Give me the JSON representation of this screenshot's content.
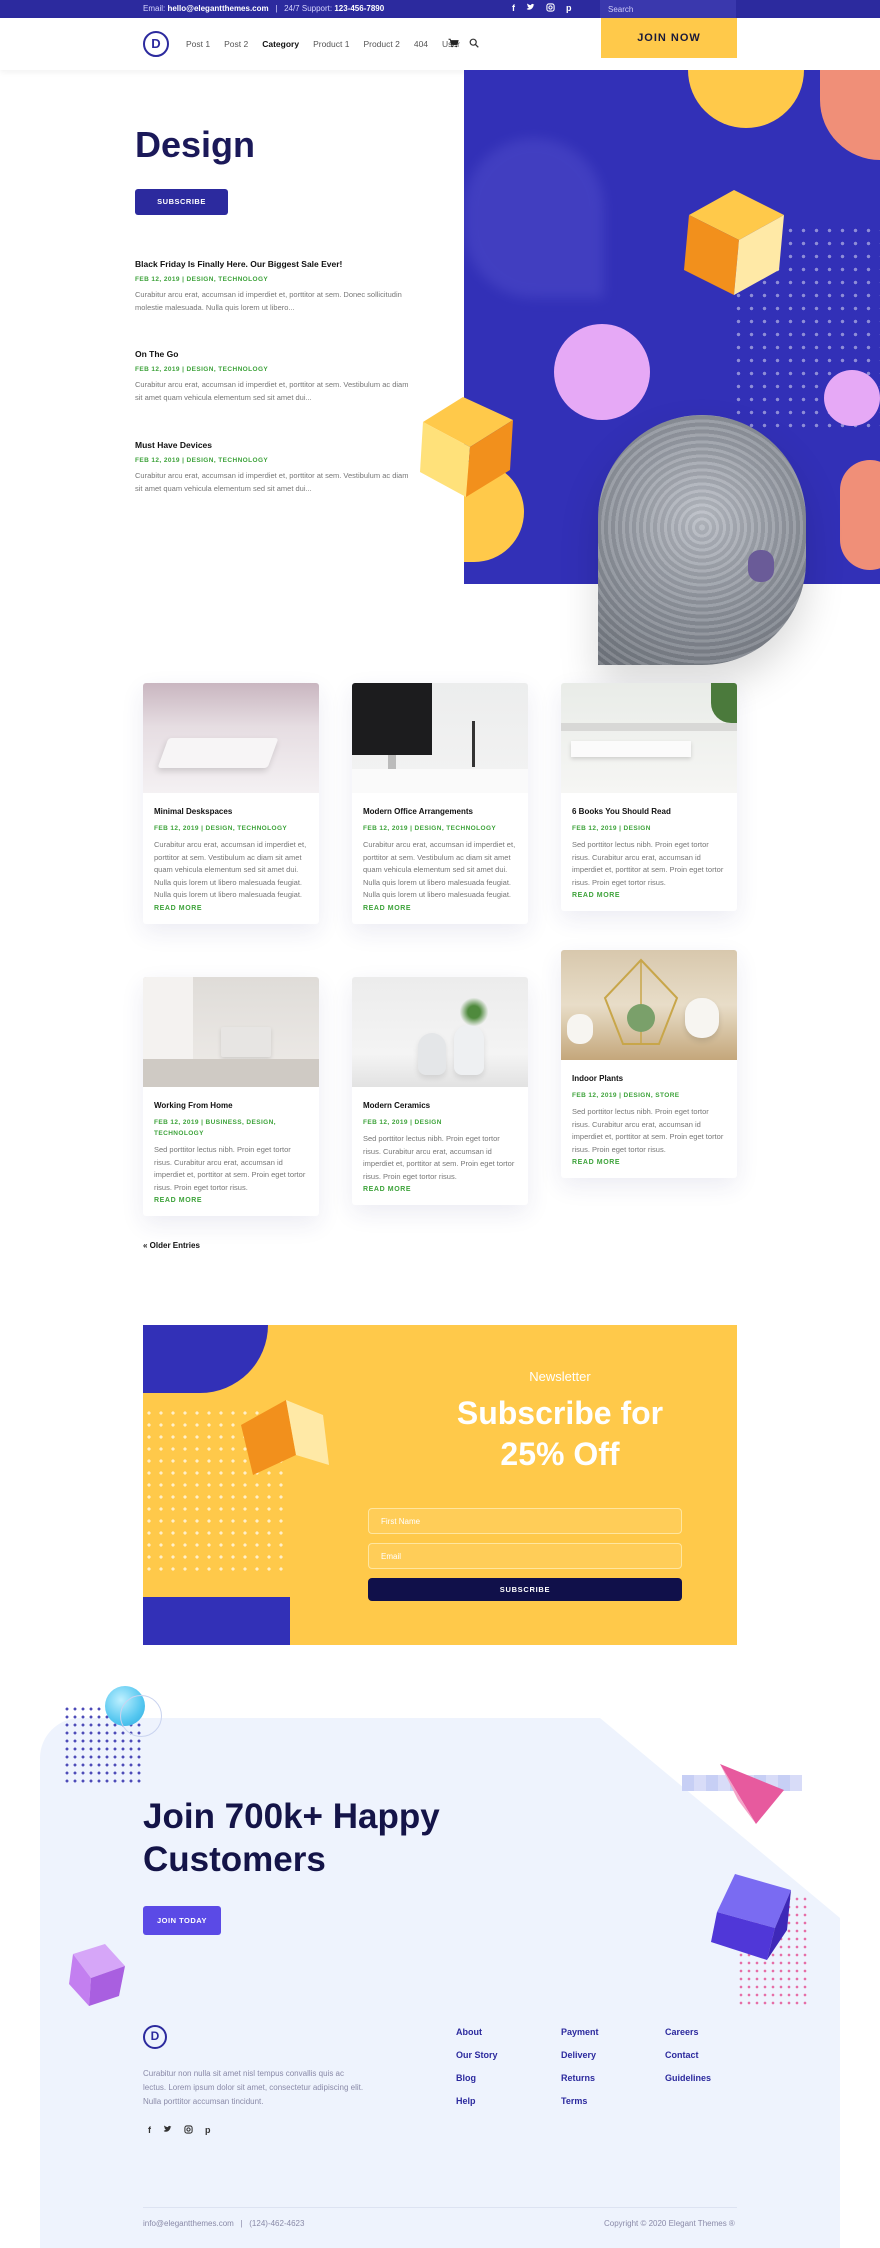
{
  "topbar": {
    "email_label": "Email:",
    "email": "hello@elegantthemes.com",
    "separator": "|",
    "support_label": "24/7 Support:",
    "phone": "123-456-7890",
    "social_icons": [
      "facebook-icon",
      "twitter-icon",
      "instagram-icon",
      "pinterest-icon"
    ],
    "search_placeholder": "Search"
  },
  "nav": {
    "logo_letter": "D",
    "items": [
      "Post 1",
      "Post 2",
      "Category",
      "Product 1",
      "Product 2",
      "404",
      "User"
    ],
    "active_item": "Category",
    "join_label": "JOIN NOW"
  },
  "hero": {
    "title": "Design",
    "subscribe_label": "SUBSCRIBE",
    "posts": [
      {
        "title": "Black Friday Is Finally Here. Our Biggest Sale Ever!",
        "meta": "FEB 12, 2019 | DESIGN, TECHNOLOGY",
        "excerpt": "Curabitur arcu erat, accumsan id imperdiet et, porttitor at sem. Donec sollicitudin molestie malesuada. Nulla quis lorem ut libero..."
      },
      {
        "title": "On The Go",
        "meta": "FEB 12, 2019 | DESIGN, TECHNOLOGY",
        "excerpt": "Curabitur arcu erat, accumsan id imperdiet et, porttitor at sem. Vestibulum ac diam sit amet quam vehicula elementum sed sit amet dui..."
      },
      {
        "title": "Must Have Devices",
        "meta": "FEB 12, 2019 | DESIGN, TECHNOLOGY",
        "excerpt": "Curabitur arcu erat, accumsan id imperdiet et, porttitor at sem. Vestibulum ac diam sit amet quam vehicula elementum sed sit amet dui..."
      }
    ]
  },
  "grid": {
    "read_more": "READ MORE",
    "cards": [
      {
        "title": "Minimal Deskspaces",
        "meta": "FEB 12, 2019 | DESIGN, TECHNOLOGY",
        "excerpt": "Curabitur arcu erat, accumsan id imperdiet et, porttitor at sem. Vestibulum ac diam sit amet quam vehicula elementum sed sit amet dui. Nulla quis lorem ut libero malesuada feugiat. Nulla quis lorem ut libero malesuada feugiat."
      },
      {
        "title": "Modern Office Arrangements",
        "meta": "FEB 12, 2019 | DESIGN, TECHNOLOGY",
        "excerpt": "Curabitur arcu erat, accumsan id imperdiet et, porttitor at sem. Vestibulum ac diam sit amet quam vehicula elementum sed sit amet dui. Nulla quis lorem ut libero malesuada feugiat. Nulla quis lorem ut libero malesuada feugiat."
      },
      {
        "title": "6 Books You Should Read",
        "meta": "FEB 12, 2019 | DESIGN",
        "excerpt": "Sed porttitor lectus nibh. Proin eget tortor risus. Curabitur arcu erat, accumsan id imperdiet et, porttitor at sem. Proin eget tortor risus. Proin eget tortor risus."
      },
      {
        "title": "Working From Home",
        "meta": "FEB 12, 2019 | BUSINESS, DESIGN, TECHNOLOGY",
        "excerpt": "Sed porttitor lectus nibh. Proin eget tortor risus. Curabitur arcu erat, accumsan id imperdiet et, porttitor at sem. Proin eget tortor risus. Proin eget tortor risus."
      },
      {
        "title": "Modern Ceramics",
        "meta": "FEB 12, 2019 | DESIGN",
        "excerpt": "Sed porttitor lectus nibh. Proin eget tortor risus. Curabitur arcu erat, accumsan id imperdiet et, porttitor at sem. Proin eget tortor risus. Proin eget tortor risus."
      },
      {
        "title": "Indoor Plants",
        "meta": "FEB 12, 2019 | DESIGN, STORE",
        "excerpt": "Sed porttitor lectus nibh. Proin eget tortor risus. Curabitur arcu erat, accumsan id imperdiet et, porttitor at sem. Proin eget tortor risus. Proin eget tortor risus."
      }
    ],
    "older_entries": "« Older Entries"
  },
  "newsletter": {
    "label": "Newsletter",
    "title_line1": "Subscribe for",
    "title_line2": "25% Off",
    "first_name_placeholder": "First Name",
    "email_placeholder": "Email",
    "button_label": "SUBSCRIBE"
  },
  "join": {
    "title_line1": "Join 700k+ Happy",
    "title_line2": "Customers",
    "button_label": "JOIN TODAY"
  },
  "footer": {
    "logo_letter": "D",
    "description": "Curabitur non nulla sit amet nisl tempus convallis quis ac lectus. Lorem ipsum dolor sit amet, consectetur adipiscing elit. Nulla porttitor accumsan tincidunt.",
    "social_icons": [
      "facebook-icon",
      "twitter-icon",
      "instagram-icon",
      "pinterest-icon"
    ],
    "col1": [
      "About",
      "Our Story",
      "Blog",
      "Help"
    ],
    "col2": [
      "Payment",
      "Delivery",
      "Returns",
      "Terms"
    ],
    "col3": [
      "Careers",
      "Contact",
      "Guidelines"
    ],
    "contact_email": "info@elegantthemes.com",
    "contact_sep": "|",
    "contact_phone": "(124)-462-4623",
    "copyright": "Copyright © 2020 Elegant Themes ®"
  },
  "colors": {
    "primary": "#2c2a9e",
    "accent_yellow": "#ffc94a",
    "accent_green": "#3ea33b",
    "dark_navy": "#10104a",
    "footer_bg": "#eef3fd"
  }
}
